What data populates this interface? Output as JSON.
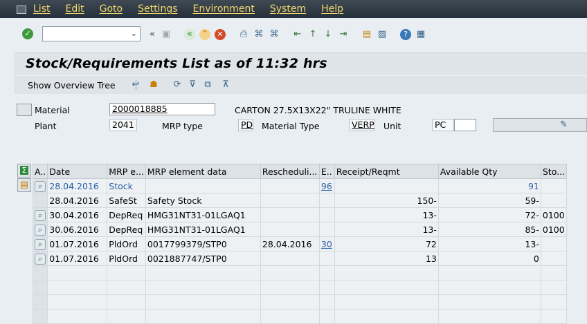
{
  "menubar": {
    "items": [
      "List",
      "Edit",
      "Goto",
      "Settings",
      "Environment",
      "System",
      "Help"
    ]
  },
  "toolbar": {
    "command_value": "",
    "icons": [
      "ok-check-icon",
      "command-dropdown-icon",
      "collapse-icon",
      "save-icon",
      "back-icon",
      "exit-icon",
      "cancel-icon",
      "print-icon",
      "find-icon",
      "find-next-icon",
      "first-page-icon",
      "prev-page-icon",
      "next-page-icon",
      "last-page-icon",
      "new-session-icon",
      "shortcut-icon",
      "help-icon",
      "customize-layout-icon"
    ]
  },
  "title": "Stock/Requirements List as of 11:32 hrs",
  "app_toolbar": {
    "show_overview_tree": "Show Overview Tree"
  },
  "header": {
    "material_label": "Material",
    "material_value": "2000018885",
    "material_desc": "CARTON 27.5X13X22\" TRULINE WHITE",
    "plant_label": "Plant",
    "plant_value": "2041",
    "mrp_type_label": "MRP type",
    "mrp_type_value": "PD",
    "material_type_label": "Material Type",
    "material_type_value": "VERP",
    "unit_label": "Unit",
    "unit_value": "PC"
  },
  "grid": {
    "columns": [
      "A..",
      "Date",
      "MRP e...",
      "MRP element data",
      "Rescheduli...",
      "E..",
      "Receipt/Reqmt",
      "Available Qty",
      "Sto..."
    ],
    "rows": [
      {
        "date": "28.04.2016",
        "mrp_element": "Stock",
        "mrp_data": "",
        "resched": "",
        "e": "96",
        "receipt": "",
        "available": "91",
        "sto": "",
        "blue": true,
        "has_icon": true
      },
      {
        "date": "28.04.2016",
        "mrp_element": "SafeSt",
        "mrp_data": "Safety Stock",
        "resched": "",
        "e": "",
        "receipt": "150-",
        "available": "59-",
        "sto": "",
        "blue": false,
        "has_icon": false
      },
      {
        "date": "30.04.2016",
        "mrp_element": "DepReq",
        "mrp_data": "HMG31NT31-01LGAQ1",
        "resched": "",
        "e": "",
        "receipt": "13-",
        "available": "72-",
        "sto": "0100",
        "blue": false,
        "has_icon": true
      },
      {
        "date": "30.06.2016",
        "mrp_element": "DepReq",
        "mrp_data": "HMG31NT31-01LGAQ1",
        "resched": "",
        "e": "",
        "receipt": "13-",
        "available": "85-",
        "sto": "0100",
        "blue": false,
        "has_icon": true
      },
      {
        "date": "01.07.2016",
        "mrp_element": "PldOrd",
        "mrp_data": "0017799379/STP0",
        "resched": "28.04.2016",
        "e": "30",
        "receipt": "72",
        "available": "13-",
        "sto": "",
        "blue": false,
        "has_icon": true
      },
      {
        "date": "01.07.2016",
        "mrp_element": "PldOrd",
        "mrp_data": "0021887747/STP0",
        "resched": "",
        "e": "",
        "receipt": "13",
        "available": "0",
        "sto": "",
        "blue": false,
        "has_icon": true
      }
    ]
  },
  "colors": {
    "menubar_text": "#f4d96c",
    "link": "#2a5fa8"
  }
}
